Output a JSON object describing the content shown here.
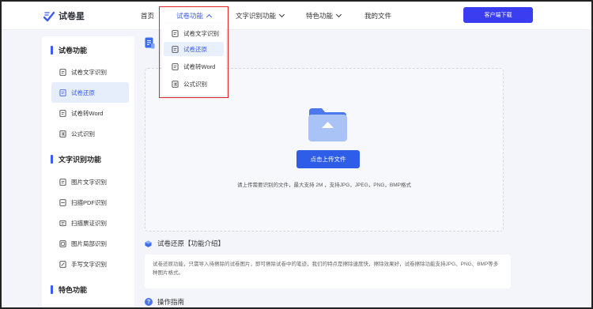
{
  "brand": {
    "name": "试卷星"
  },
  "nav": {
    "home": "首页",
    "exam_functions": "试卷功能",
    "text_recognition": "文字识别功能",
    "special_functions": "特色功能",
    "my_files": "我的文件"
  },
  "header": {
    "download_button": "客户端下载"
  },
  "dropdown": {
    "items": [
      "试卷文字识别",
      "试卷还原",
      "试卷转Word",
      "公式识别"
    ],
    "selected": "试卷还原"
  },
  "sidebar": {
    "sections": [
      {
        "title": "试卷功能",
        "items": [
          "试卷文字识别",
          "试卷还原",
          "试卷转Word",
          "公式识别"
        ]
      },
      {
        "title": "文字识别功能",
        "items": [
          "图片文字识别",
          "扫描PDF识别",
          "扫描票证识别",
          "图片局部识别",
          "手写文字识别"
        ]
      },
      {
        "title": "特色功能",
        "items": []
      }
    ],
    "active": "试卷还原"
  },
  "upload": {
    "button_label": "点击上传文件",
    "hint": "请上传需要识别的文件，最大支持 2M ，支持JPG，JPEG，PNG，BMP格式"
  },
  "intro": {
    "title": "试卷还原【功能介绍】",
    "text": "试卷还原功能，只需导入待擦除的试卷图片，即可擦除试卷中的笔迹，我们的特点是擦除速度快，擦除效果好，试卷擦除功能支持JPG、PNG、BMP等多种图片格式。"
  },
  "guide": {
    "title": "操作指南"
  },
  "colors": {
    "accent": "#3a5cf5",
    "download_button": "#3b3ef0",
    "upload_button": "#2e5de8",
    "highlight_box": "#e0262a"
  }
}
